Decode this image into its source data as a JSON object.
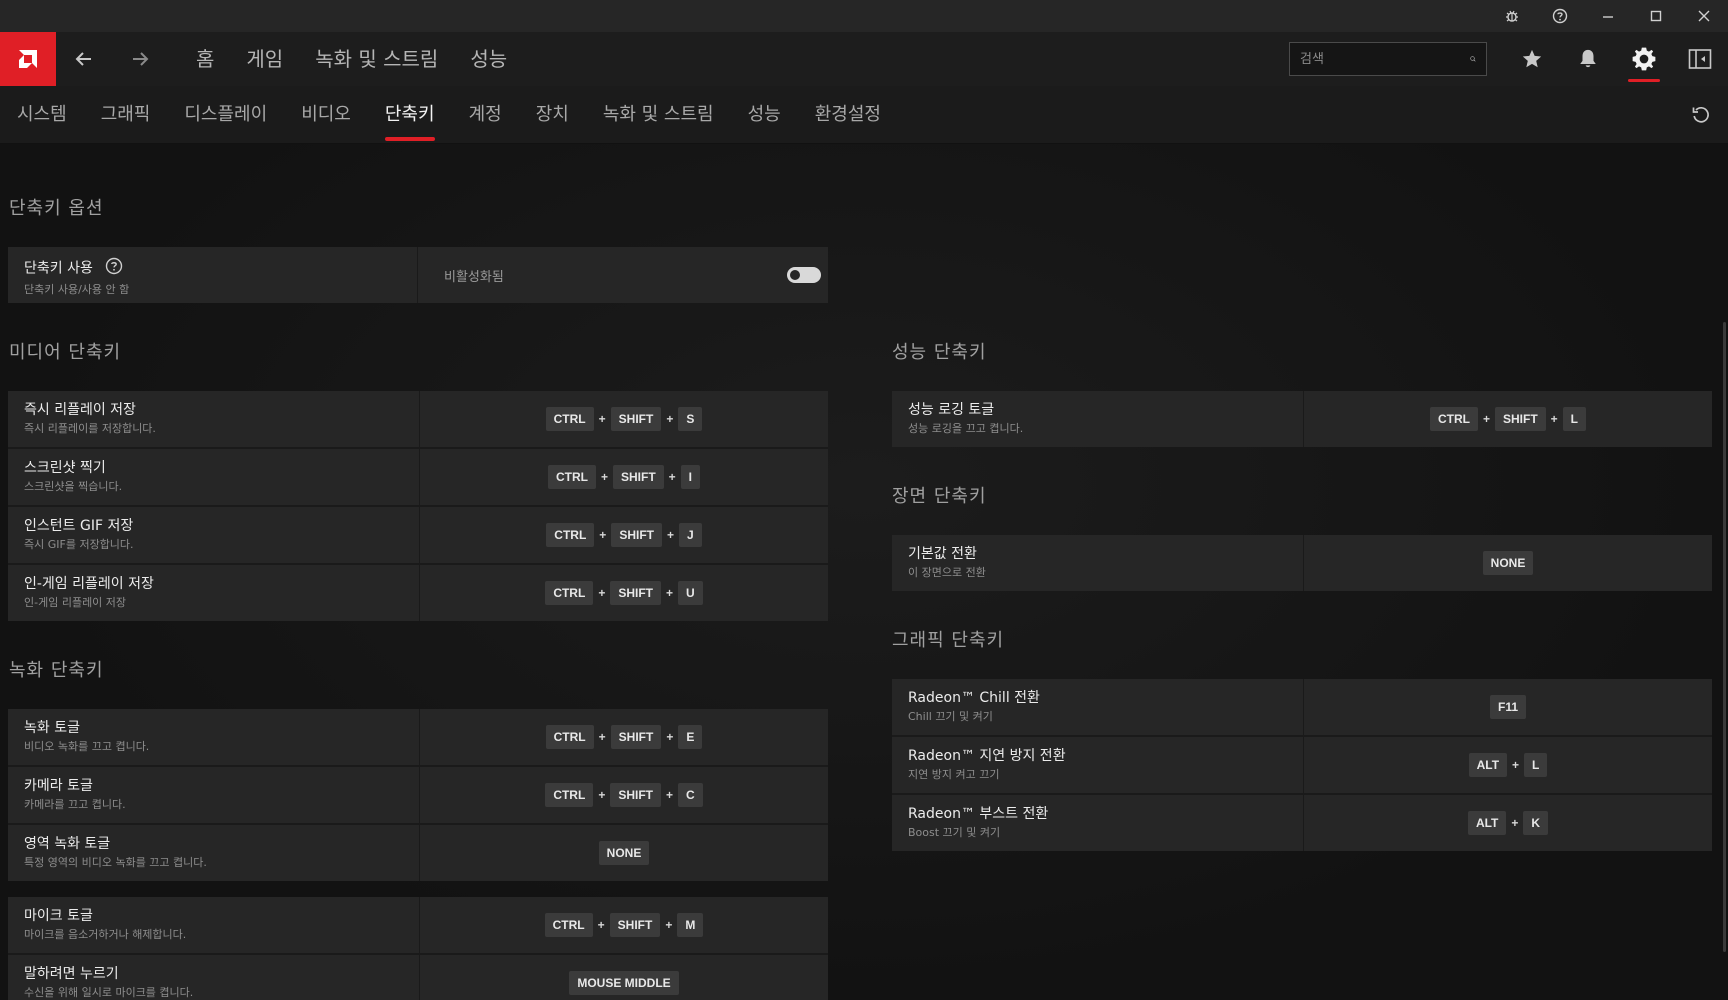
{
  "window_controls": {
    "bug_icon": "bug-icon",
    "help_icon": "help-icon",
    "minimize_icon": "minimize-icon",
    "maximize_icon": "maximize-icon",
    "close_icon": "close-icon"
  },
  "topnav": {
    "links": [
      "홈",
      "게임",
      "녹화 및 스트림",
      "성능"
    ],
    "search_placeholder": "검색"
  },
  "subnav": {
    "tabs": [
      "시스템",
      "그래픽",
      "디스플레이",
      "비디오",
      "단축키",
      "계정",
      "장치",
      "녹화 및 스트림",
      "성능",
      "환경설정"
    ],
    "active_tab": "단축키"
  },
  "accent_color": "#e01f26",
  "hotkey_options": {
    "title": "단축키 옵션",
    "enable": {
      "label": "단축키 사용",
      "sub": "단축키 사용/사용 안 함",
      "status": "비활성화됨",
      "enabled": false
    }
  },
  "media_hotkeys": {
    "title": "미디어 단축키",
    "rows": [
      {
        "label": "즉시 리플레이 저장",
        "sub": "즉시 리플레이를 저장합니다.",
        "keys": [
          "CTRL",
          "SHIFT",
          "S"
        ]
      },
      {
        "label": "스크린샷 찍기",
        "sub": "스크린샷을 찍습니다.",
        "keys": [
          "CTRL",
          "SHIFT",
          "I"
        ]
      },
      {
        "label": "인스턴트 GIF 저장",
        "sub": "즉시 GIF를 저장합니다.",
        "keys": [
          "CTRL",
          "SHIFT",
          "J"
        ]
      },
      {
        "label": "인-게임 리플레이 저장",
        "sub": "인-게임 리플레이 저장",
        "keys": [
          "CTRL",
          "SHIFT",
          "U"
        ]
      }
    ]
  },
  "recording_hotkeys": {
    "title": "녹화 단축키",
    "rows": [
      {
        "label": "녹화 토글",
        "sub": "비디오 녹화를 끄고 켭니다.",
        "keys": [
          "CTRL",
          "SHIFT",
          "E"
        ]
      },
      {
        "label": "카메라 토글",
        "sub": "카메라를 끄고 켭니다.",
        "keys": [
          "CTRL",
          "SHIFT",
          "C"
        ]
      },
      {
        "label": "영역 녹화 토글",
        "sub": "특정 영역의 비디오 녹화를 끄고 켭니다.",
        "keys": [
          "NONE"
        ]
      }
    ],
    "rows2": [
      {
        "label": "마이크 토글",
        "sub": "마이크를 음소거하거나 해제합니다.",
        "keys": [
          "CTRL",
          "SHIFT",
          "M"
        ]
      },
      {
        "label": "말하려면 누르기",
        "sub": "수신을 위해 일시로 마이크를 켭니다.",
        "keys": [
          "MOUSE MIDDLE"
        ]
      }
    ]
  },
  "performance_hotkeys": {
    "title": "성능 단축키",
    "rows": [
      {
        "label": "성능 로깅 토글",
        "sub": "성능 로깅을 끄고 켭니다.",
        "keys": [
          "CTRL",
          "SHIFT",
          "L"
        ]
      }
    ]
  },
  "scene_hotkeys": {
    "title": "장면 단축키",
    "rows": [
      {
        "label": "기본값 전환",
        "sub": "이 장면으로 전환",
        "keys": [
          "NONE"
        ]
      }
    ]
  },
  "graphics_hotkeys": {
    "title": "그래픽 단축키",
    "rows": [
      {
        "label": "Radeon™ Chill 전환",
        "sub": "Chill 끄기 및 켜기",
        "keys": [
          "F11"
        ]
      },
      {
        "label": "Radeon™ 지연 방지 전환",
        "sub": "지연 방지 켜고 끄기",
        "keys": [
          "ALT",
          "L"
        ]
      },
      {
        "label": "Radeon™ 부스트 전환",
        "sub": "Boost 끄기 및 켜기",
        "keys": [
          "ALT",
          "K"
        ]
      }
    ]
  }
}
